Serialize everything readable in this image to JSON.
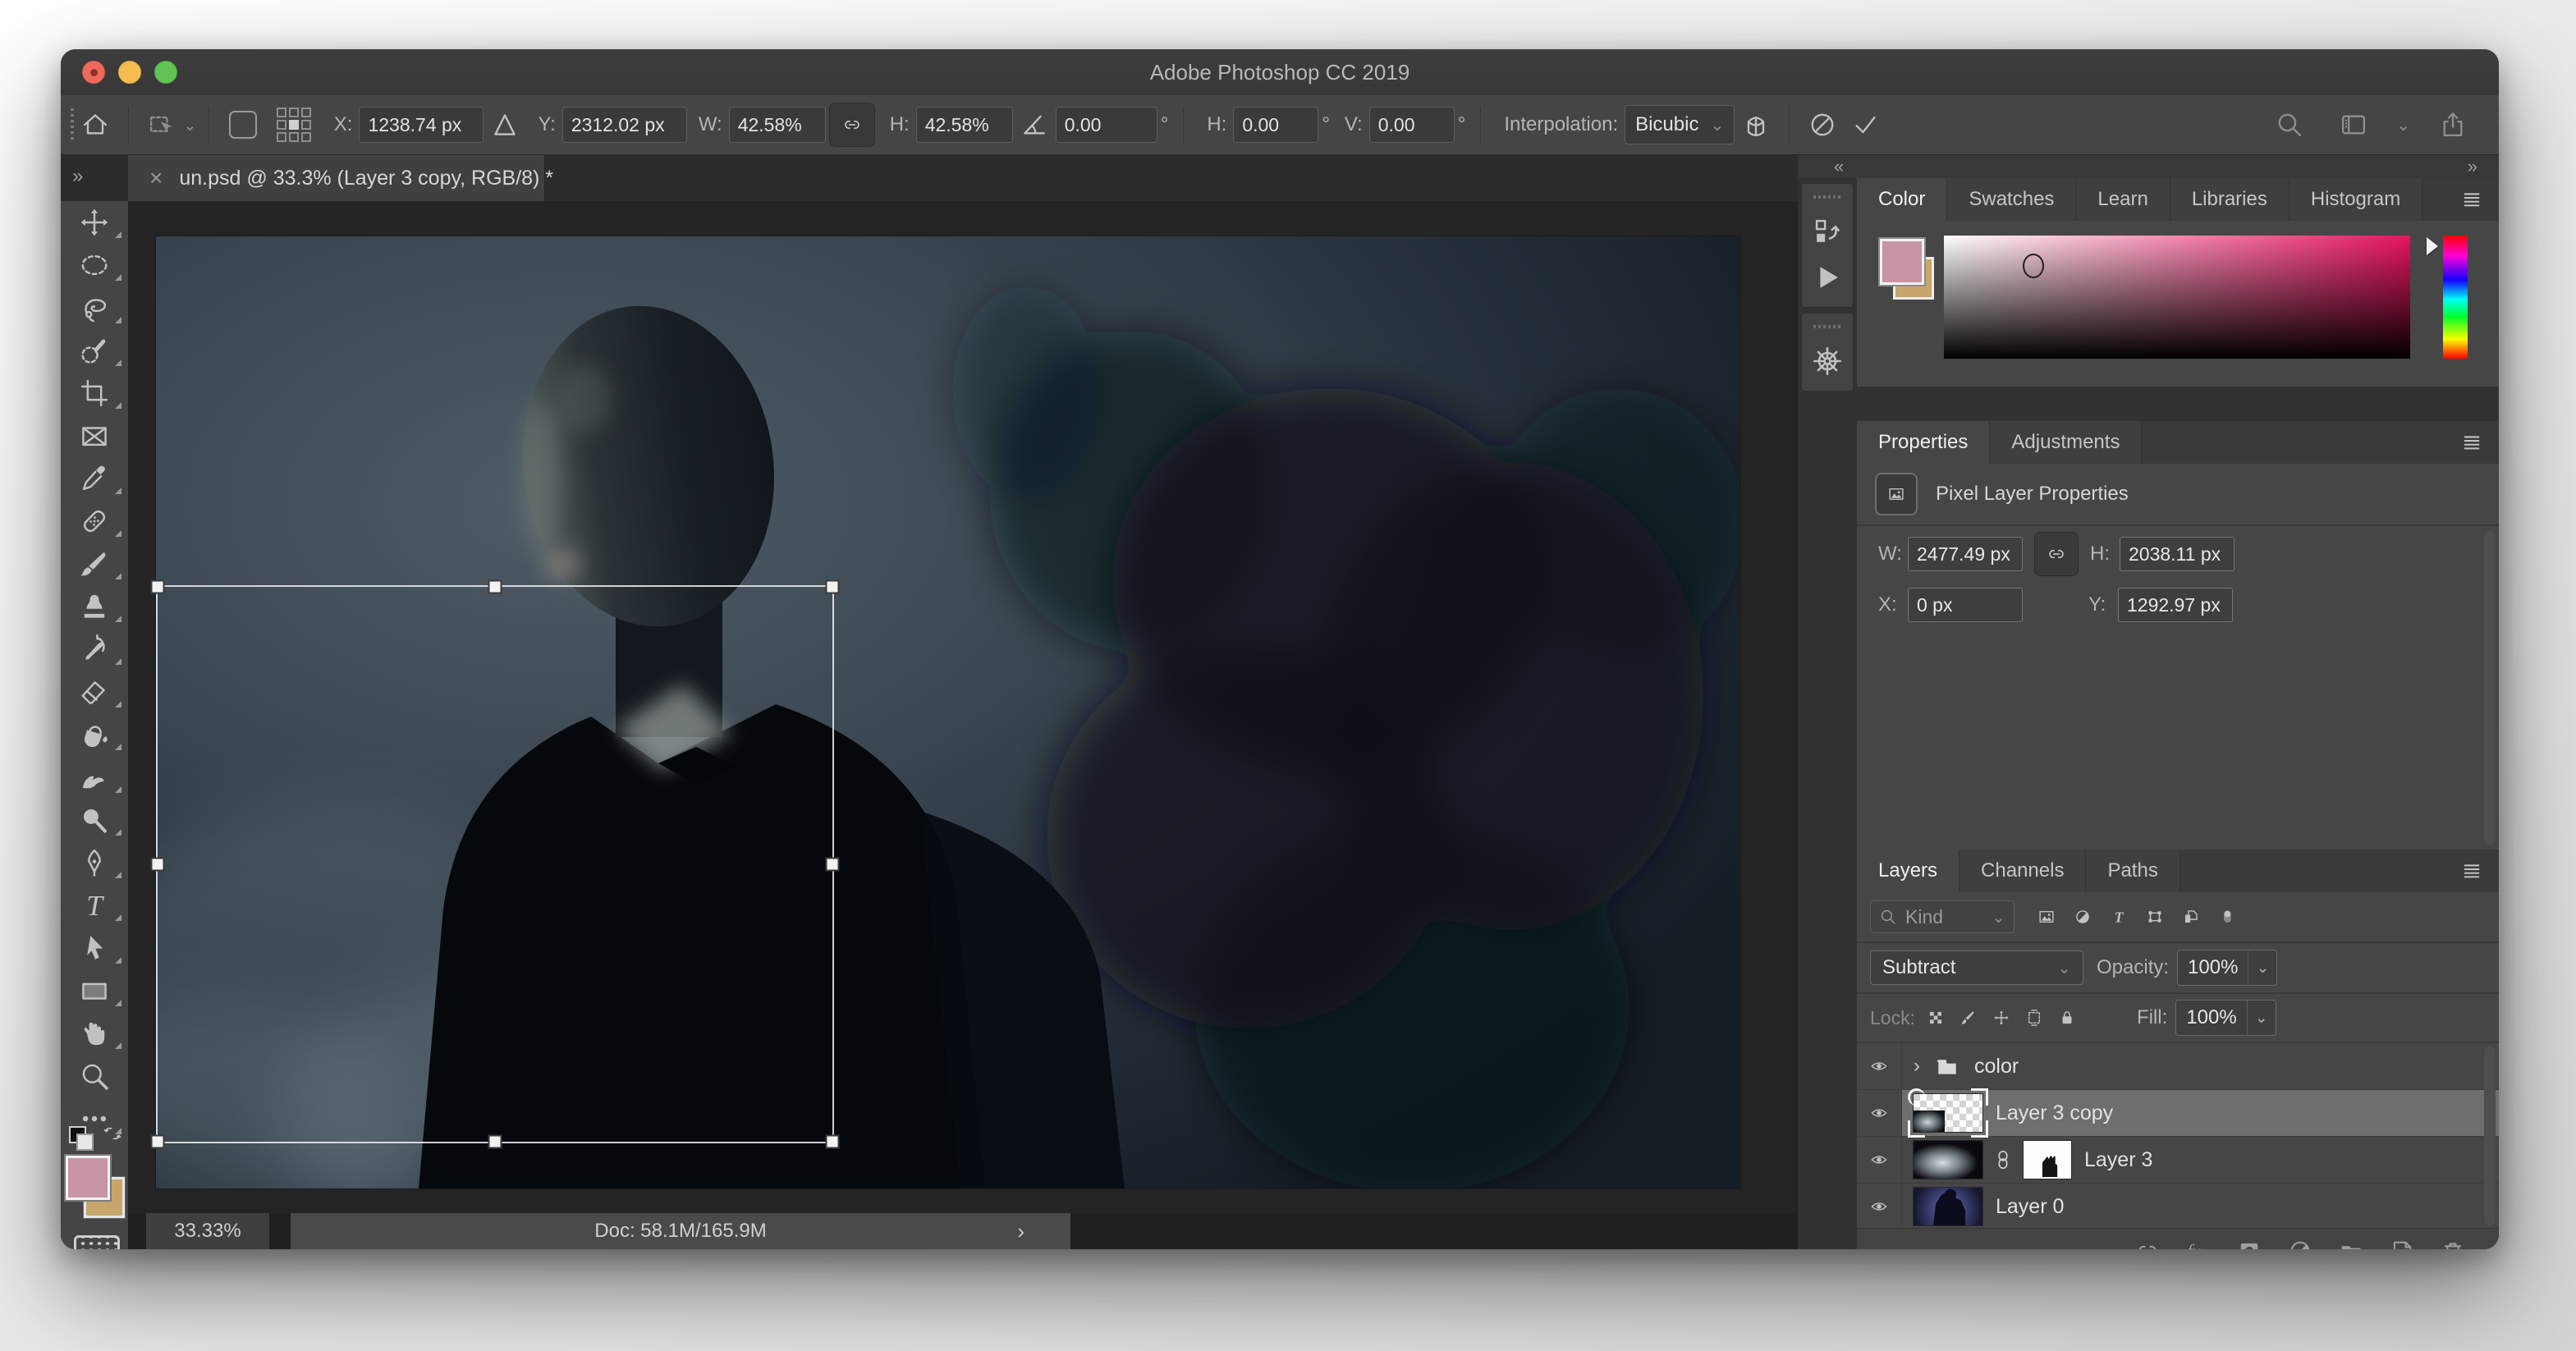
{
  "window": {
    "title": "Adobe Photoshop CC 2019"
  },
  "options_bar": {
    "x_label": "X:",
    "x_value": "1238.74 px",
    "y_label": "Y:",
    "y_value": "2312.02 px",
    "w_label": "W:",
    "w_value": "42.58%",
    "h_label": "H:",
    "h_value": "42.58%",
    "angle_value": "0.00",
    "angle_unit": "°",
    "h_skew_label": "H:",
    "h_skew_value": "0.00",
    "h_skew_unit": "°",
    "v_skew_label": "V:",
    "v_skew_value": "0.00",
    "v_skew_unit": "°",
    "interpolation_label": "Interpolation:",
    "interpolation_value": "Bicubic"
  },
  "document_tab": {
    "close_glyph": "×",
    "title": "un.psd @ 33.3% (Layer 3 copy, RGB/8) *"
  },
  "tools_dock": {
    "expand_glyph": "»",
    "foreground_color": "#c795a3",
    "background_color": "#c8a56b",
    "tools": [
      {
        "id": "move",
        "flyout": true
      },
      {
        "id": "elliptical-marquee",
        "flyout": true
      },
      {
        "id": "lasso",
        "flyout": true
      },
      {
        "id": "quick-selection",
        "flyout": true
      },
      {
        "id": "crop",
        "flyout": true
      },
      {
        "id": "frame",
        "flyout": false
      },
      {
        "id": "eyedropper",
        "flyout": true
      },
      {
        "id": "spot-healing-brush",
        "flyout": true
      },
      {
        "id": "brush",
        "flyout": true
      },
      {
        "id": "clone-stamp",
        "flyout": true
      },
      {
        "id": "history-brush",
        "flyout": true
      },
      {
        "id": "eraser",
        "flyout": true
      },
      {
        "id": "paint-bucket",
        "flyout": true
      },
      {
        "id": "smudge",
        "flyout": true
      },
      {
        "id": "dodge",
        "flyout": true
      },
      {
        "id": "pen",
        "flyout": true
      },
      {
        "id": "type",
        "flyout": true
      },
      {
        "id": "path-selection",
        "flyout": true
      },
      {
        "id": "rectangle",
        "flyout": true
      },
      {
        "id": "hand",
        "flyout": true
      },
      {
        "id": "zoom",
        "flyout": false
      },
      {
        "id": "more-tools",
        "flyout": true
      }
    ]
  },
  "dock": {
    "collapse_glyph": "«",
    "expand_glyph": "»"
  },
  "color_panel": {
    "tabs": [
      "Color",
      "Swatches",
      "Learn",
      "Libraries",
      "Histogram"
    ],
    "active_tab": "Color",
    "foreground_color": "#c795a3",
    "background_color": "#c8a56b",
    "hue_color": "#e8145f"
  },
  "properties_panel": {
    "tabs": [
      "Properties",
      "Adjustments"
    ],
    "active_tab": "Properties",
    "header": "Pixel Layer Properties",
    "w_label": "W:",
    "w_value": "2477.49 px",
    "h_label": "H:",
    "h_value": "2038.11 px",
    "x_label": "X:",
    "x_value": "0 px",
    "y_label": "Y:",
    "y_value": "1292.97 px"
  },
  "layers_panel": {
    "tabs": [
      "Layers",
      "Channels",
      "Paths"
    ],
    "active_tab": "Layers",
    "filter_label": "Kind",
    "blend_mode": "Subtract",
    "opacity_label": "Opacity:",
    "opacity_value": "100%",
    "lock_label": "Lock:",
    "fill_label": "Fill:",
    "fill_value": "100%",
    "layers": [
      {
        "name": "color",
        "type": "group",
        "visible": true,
        "selected": false
      },
      {
        "name": "Layer 3 copy",
        "type": "pixel",
        "visible": true,
        "selected": true
      },
      {
        "name": "Layer 3",
        "type": "pixel-with-mask",
        "visible": true,
        "selected": false
      },
      {
        "name": "Layer 0",
        "type": "pixel",
        "visible": true,
        "selected": false
      }
    ]
  },
  "status_bar": {
    "zoom": "33.33%",
    "doc_info": "Doc: 58.1M/165.9M",
    "expand_glyph": "›"
  }
}
